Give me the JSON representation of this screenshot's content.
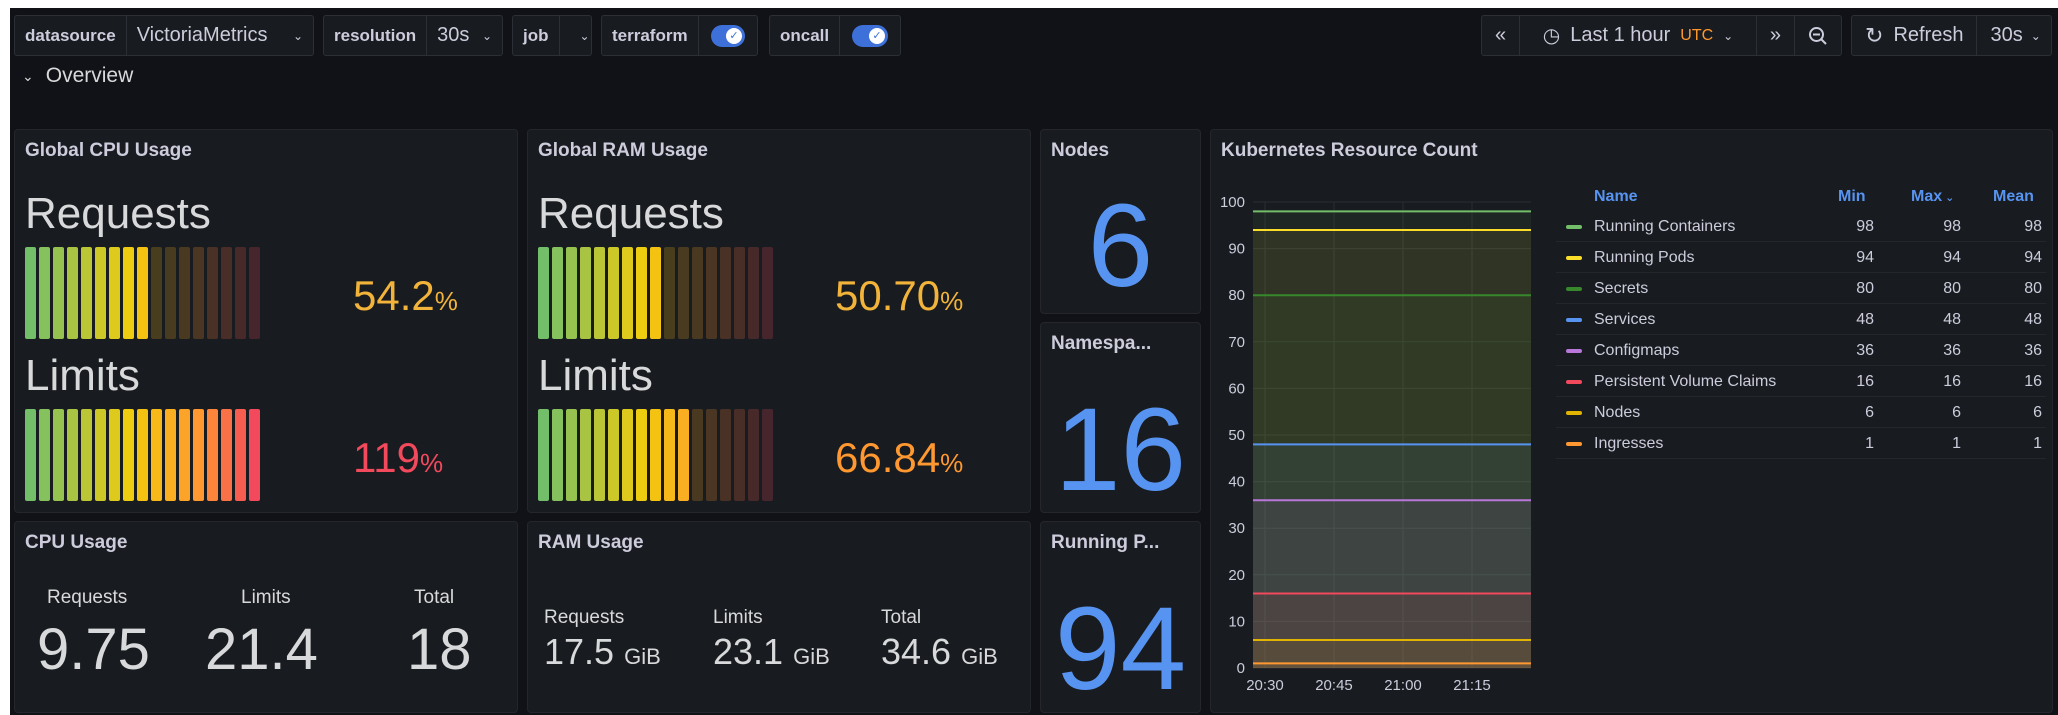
{
  "toolbar": {
    "vars": [
      {
        "label": "datasource",
        "value": "VictoriaMetrics"
      },
      {
        "label": "resolution",
        "value": "30s"
      },
      {
        "label": "job",
        "value": ""
      }
    ],
    "toggles": [
      {
        "label": "terraform",
        "on": true
      },
      {
        "label": "oncall",
        "on": true
      }
    ],
    "time_range": "Last 1 hour",
    "timezone": "UTC",
    "refresh_label": "Refresh",
    "refresh_interval": "30s"
  },
  "row_title": "Overview",
  "cpu_gauge": {
    "title": "Global CPU Usage",
    "requests_label": "Requests",
    "requests_value": "54.2",
    "requests_unit": "%",
    "requests_pct": 54.2,
    "requests_color": "#f2b33a",
    "limits_label": "Limits",
    "limits_value": "119",
    "limits_unit": "%",
    "limits_pct": 100,
    "limits_color": "#f2495c"
  },
  "ram_gauge": {
    "title": "Global RAM Usage",
    "requests_label": "Requests",
    "requests_value": "50.70",
    "requests_unit": "%",
    "requests_pct": 50.7,
    "requests_color": "#f2b33a",
    "limits_label": "Limits",
    "limits_value": "66.84",
    "limits_unit": "%",
    "limits_pct": 66.84,
    "limits_color": "#ff9830"
  },
  "nodes": {
    "title": "Nodes",
    "value": "6"
  },
  "namespaces": {
    "title": "Namespa...",
    "value": "16"
  },
  "running_pods": {
    "title": "Running P...",
    "value": "94"
  },
  "cpu_usage": {
    "title": "CPU Usage",
    "cells": [
      {
        "label": "Requests",
        "value": "9.75"
      },
      {
        "label": "Limits",
        "value": "21.4"
      },
      {
        "label": "Total",
        "value": "18"
      }
    ]
  },
  "ram_usage": {
    "title": "RAM Usage",
    "cells": [
      {
        "label": "Requests",
        "value": "17.5",
        "unit": "GiB"
      },
      {
        "label": "Limits",
        "value": "23.1",
        "unit": "GiB"
      },
      {
        "label": "Total",
        "value": "34.6",
        "unit": "GiB"
      }
    ]
  },
  "k8s": {
    "title": "Kubernetes Resource Count",
    "legend_headers": {
      "name": "Name",
      "min": "Min",
      "max": "Max",
      "mean": "Mean"
    },
    "chart_data": {
      "type": "line",
      "x": [
        "20:30",
        "20:45",
        "21:00",
        "21:15"
      ],
      "ylim": [
        0,
        100
      ],
      "yticks": [
        0,
        10,
        20,
        30,
        40,
        50,
        60,
        70,
        80,
        90,
        100
      ],
      "series": [
        {
          "name": "Running Containers",
          "color": "#73bf69",
          "min": "98",
          "max": "98",
          "mean": "98",
          "value": 98
        },
        {
          "name": "Running Pods",
          "color": "#fade2a",
          "min": "94",
          "max": "94",
          "mean": "94",
          "value": 94
        },
        {
          "name": "Secrets",
          "color": "#37872d",
          "min": "80",
          "max": "80",
          "mean": "80",
          "value": 80
        },
        {
          "name": "Services",
          "color": "#5794f2",
          "min": "48",
          "max": "48",
          "mean": "48",
          "value": 48
        },
        {
          "name": "Configmaps",
          "color": "#b877d9",
          "min": "36",
          "max": "36",
          "mean": "36",
          "value": 36
        },
        {
          "name": "Persistent Volume Claims",
          "color": "#f2495c",
          "min": "16",
          "max": "16",
          "mean": "16",
          "value": 16
        },
        {
          "name": "Nodes",
          "color": "#e0b400",
          "min": "6",
          "max": "6",
          "mean": "6",
          "value": 6
        },
        {
          "name": "Ingresses",
          "color": "#ff9830",
          "min": "1",
          "max": "1",
          "mean": "1",
          "value": 1
        }
      ]
    }
  }
}
